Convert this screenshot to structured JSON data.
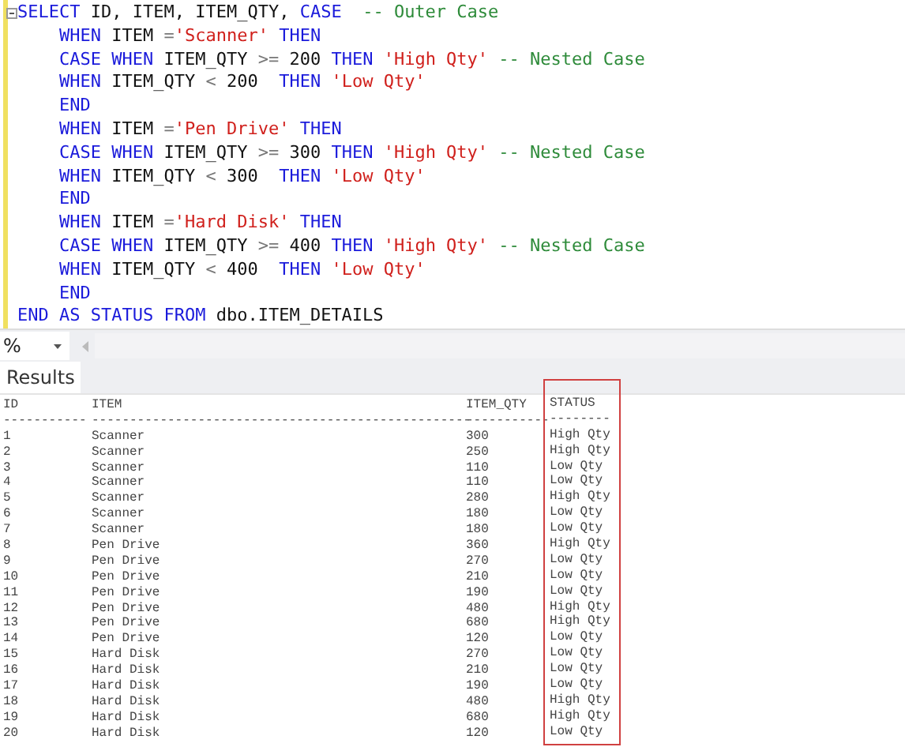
{
  "editor": {
    "lines": [
      {
        "tokens": [
          {
            "kind": "kw",
            "text": "SELECT"
          },
          {
            "kind": "id",
            "text": " ID, ITEM, ITEM_QTY, "
          },
          {
            "kind": "kw",
            "text": "CASE"
          },
          {
            "kind": "cmt",
            "text": "  -- Outer Case"
          }
        ]
      },
      {
        "tokens": [
          {
            "kind": "kw",
            "text": "    WHEN"
          },
          {
            "kind": "id",
            "text": " ITEM "
          },
          {
            "kind": "op",
            "text": "="
          },
          {
            "kind": "str",
            "text": "'Scanner'"
          },
          {
            "kind": "kw",
            "text": " THEN"
          }
        ]
      },
      {
        "tokens": [
          {
            "kind": "kw",
            "text": "    CASE WHEN"
          },
          {
            "kind": "id",
            "text": " ITEM_QTY "
          },
          {
            "kind": "op",
            "text": ">="
          },
          {
            "kind": "id",
            "text": " 200 "
          },
          {
            "kind": "kw",
            "text": "THEN"
          },
          {
            "kind": "str",
            "text": " 'High Qty'"
          },
          {
            "kind": "cmt",
            "text": " -- Nested Case"
          }
        ]
      },
      {
        "tokens": [
          {
            "kind": "kw",
            "text": "    WHEN"
          },
          {
            "kind": "id",
            "text": " ITEM_QTY "
          },
          {
            "kind": "op",
            "text": "<"
          },
          {
            "kind": "id",
            "text": " 200  "
          },
          {
            "kind": "kw",
            "text": "THEN"
          },
          {
            "kind": "str",
            "text": " 'Low Qty'"
          }
        ]
      },
      {
        "tokens": [
          {
            "kind": "kw",
            "text": "    END"
          }
        ]
      },
      {
        "tokens": [
          {
            "kind": "kw",
            "text": "    WHEN"
          },
          {
            "kind": "id",
            "text": " ITEM "
          },
          {
            "kind": "op",
            "text": "="
          },
          {
            "kind": "str",
            "text": "'Pen Drive'"
          },
          {
            "kind": "kw",
            "text": " THEN"
          }
        ]
      },
      {
        "tokens": [
          {
            "kind": "kw",
            "text": "    CASE WHEN"
          },
          {
            "kind": "id",
            "text": " ITEM_QTY "
          },
          {
            "kind": "op",
            "text": ">="
          },
          {
            "kind": "id",
            "text": " 300 "
          },
          {
            "kind": "kw",
            "text": "THEN"
          },
          {
            "kind": "str",
            "text": " 'High Qty'"
          },
          {
            "kind": "cmt",
            "text": " -- Nested Case"
          }
        ]
      },
      {
        "tokens": [
          {
            "kind": "kw",
            "text": "    WHEN"
          },
          {
            "kind": "id",
            "text": " ITEM_QTY "
          },
          {
            "kind": "op",
            "text": "<"
          },
          {
            "kind": "id",
            "text": " 300  "
          },
          {
            "kind": "kw",
            "text": "THEN"
          },
          {
            "kind": "str",
            "text": " 'Low Qty'"
          }
        ]
      },
      {
        "tokens": [
          {
            "kind": "kw",
            "text": "    END"
          }
        ]
      },
      {
        "tokens": [
          {
            "kind": "kw",
            "text": "    WHEN"
          },
          {
            "kind": "id",
            "text": " ITEM "
          },
          {
            "kind": "op",
            "text": "="
          },
          {
            "kind": "str",
            "text": "'Hard Disk'"
          },
          {
            "kind": "kw",
            "text": " THEN"
          }
        ]
      },
      {
        "tokens": [
          {
            "kind": "kw",
            "text": "    CASE WHEN"
          },
          {
            "kind": "id",
            "text": " ITEM_QTY "
          },
          {
            "kind": "op",
            "text": ">="
          },
          {
            "kind": "id",
            "text": " 400 "
          },
          {
            "kind": "kw",
            "text": "THEN"
          },
          {
            "kind": "str",
            "text": " 'High Qty'"
          },
          {
            "kind": "cmt",
            "text": " -- Nested Case"
          }
        ]
      },
      {
        "tokens": [
          {
            "kind": "kw",
            "text": "    WHEN"
          },
          {
            "kind": "id",
            "text": " ITEM_QTY "
          },
          {
            "kind": "op",
            "text": "<"
          },
          {
            "kind": "id",
            "text": " 400  "
          },
          {
            "kind": "kw",
            "text": "THEN"
          },
          {
            "kind": "str",
            "text": " 'Low Qty'"
          }
        ]
      },
      {
        "tokens": [
          {
            "kind": "kw",
            "text": "    END"
          }
        ]
      },
      {
        "tokens": [
          {
            "kind": "kw",
            "text": "END AS STATUS FROM"
          },
          {
            "kind": "id",
            "text": " dbo.ITEM_DETAILS"
          }
        ]
      }
    ]
  },
  "zoom": {
    "value": "%"
  },
  "tabs": [
    {
      "label": "Results",
      "selected": true
    }
  ],
  "results": {
    "columns": [
      {
        "header": "ID",
        "rule": "-----------",
        "highlighted": false
      },
      {
        "header": "ITEM",
        "rule": "--------------------------------------------------",
        "highlighted": false
      },
      {
        "header": "ITEM_QTY",
        "rule": "-----------",
        "highlighted": false
      },
      {
        "header": "STATUS",
        "rule": "--------",
        "highlighted": true
      }
    ],
    "rows": [
      [
        "1",
        "Scanner",
        "300",
        "High Qty"
      ],
      [
        "2",
        "Scanner",
        "250",
        "High Qty"
      ],
      [
        "3",
        "Scanner",
        "110",
        "Low Qty"
      ],
      [
        "4",
        "Scanner",
        "110",
        "Low Qty"
      ],
      [
        "5",
        "Scanner",
        "280",
        "High Qty"
      ],
      [
        "6",
        "Scanner",
        "180",
        "Low Qty"
      ],
      [
        "7",
        "Scanner",
        "180",
        "Low Qty"
      ],
      [
        "8",
        "Pen Drive",
        "360",
        "High Qty"
      ],
      [
        "9",
        "Pen Drive",
        "270",
        "Low Qty"
      ],
      [
        "10",
        "Pen Drive",
        "210",
        "Low Qty"
      ],
      [
        "11",
        "Pen Drive",
        "190",
        "Low Qty"
      ],
      [
        "12",
        "Pen Drive",
        "480",
        "High Qty"
      ],
      [
        "13",
        "Pen Drive",
        "680",
        "High Qty"
      ],
      [
        "14",
        "Pen Drive",
        "120",
        "Low Qty"
      ],
      [
        "15",
        "Hard Disk",
        "270",
        "Low Qty"
      ],
      [
        "16",
        "Hard Disk",
        "210",
        "Low Qty"
      ],
      [
        "17",
        "Hard Disk",
        "190",
        "Low Qty"
      ],
      [
        "18",
        "Hard Disk",
        "480",
        "High Qty"
      ],
      [
        "19",
        "Hard Disk",
        "680",
        "High Qty"
      ],
      [
        "20",
        "Hard Disk",
        "120",
        "Low Qty"
      ]
    ]
  }
}
